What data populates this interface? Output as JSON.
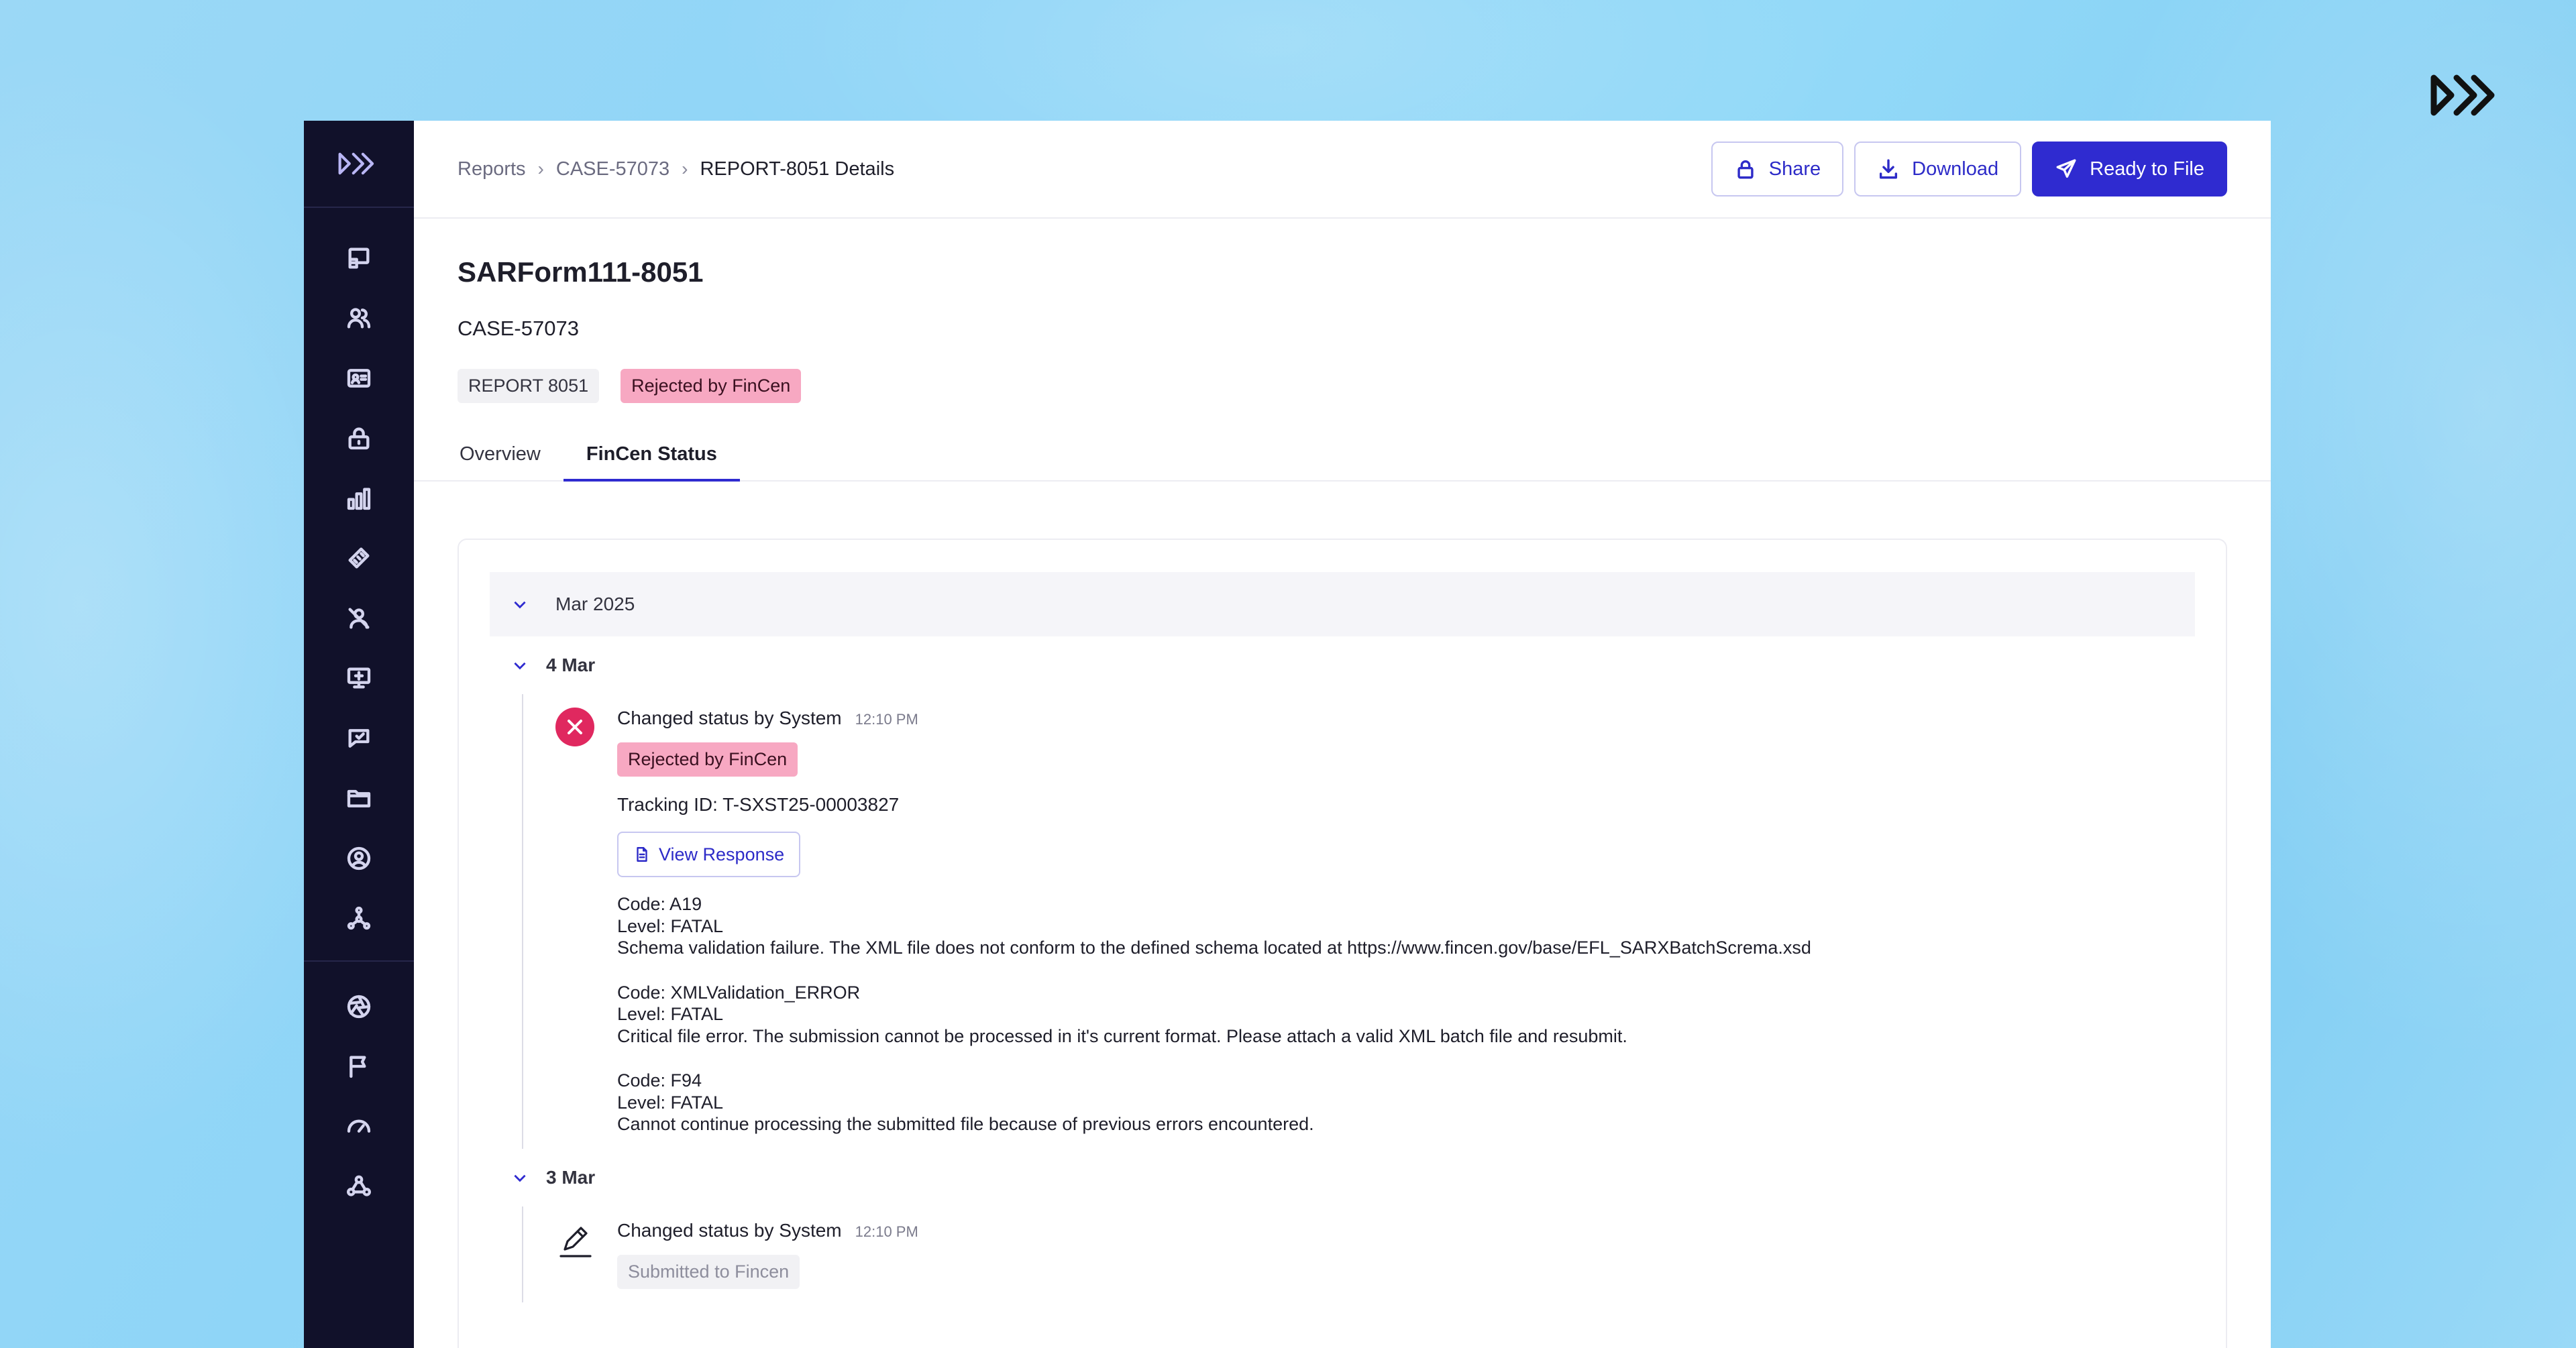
{
  "breadcrumb": {
    "items": [
      "Reports",
      "CASE-57073"
    ],
    "current": "REPORT-8051 Details"
  },
  "actions": {
    "share": "Share",
    "download": "Download",
    "ready": "Ready to File"
  },
  "report": {
    "title": "SARForm111-8051",
    "case_id": "CASE-57073",
    "report_tag": "REPORT 8051",
    "status_tag": "Rejected by FinCen"
  },
  "tabs": [
    "Overview",
    "FinCen Status"
  ],
  "active_tab": "FinCen Status",
  "timeline": {
    "month": "Mar 2025",
    "days": [
      {
        "label": "4 Mar",
        "event": {
          "title": "Changed status by System",
          "time": "12:10 PM",
          "status": "Rejected by FinCen",
          "tracking": "Tracking ID: T-SXST25-00003827",
          "view_response": "View Response",
          "errors": [
            {
              "code": "Code: A19",
              "level": "Level: FATAL",
              "message": "Schema validation failure. The XML file does not conform to the defined schema located at https://www.fincen.gov/base/EFL_SARXBatchScrema.xsd"
            },
            {
              "code": "Code: XMLValidation_ERROR",
              "level": "Level: FATAL",
              "message": "Critical file error. The submission cannot be processed in it's current format. Please attach a valid XML batch file and resubmit."
            },
            {
              "code": "Code: F94",
              "level": "Level: FATAL",
              "message": "Cannot continue processing the submitted file because of previous errors encountered."
            }
          ]
        }
      },
      {
        "label": "3 Mar",
        "event": {
          "title": "Changed status by System",
          "time": "12:10 PM",
          "status": "Submitted to Fincen"
        }
      }
    ]
  },
  "sidebar": {
    "icons_top": [
      "dashboard-icon",
      "users-icon",
      "id-card-icon",
      "lock-group-icon",
      "bar-chart-icon",
      "ruler-icon",
      "user-off-icon",
      "monitor-icon",
      "checklist-icon",
      "folder-icon",
      "user-circle-icon",
      "network-icon"
    ],
    "icons_bottom": [
      "aperture-icon",
      "flag-icon",
      "gauge-icon",
      "webhook-icon"
    ]
  },
  "colors": {
    "accent": "#2f2bd0",
    "sidebar": "#11112a",
    "rejected": "#f7a8c2",
    "error_icon": "#e0285f"
  }
}
